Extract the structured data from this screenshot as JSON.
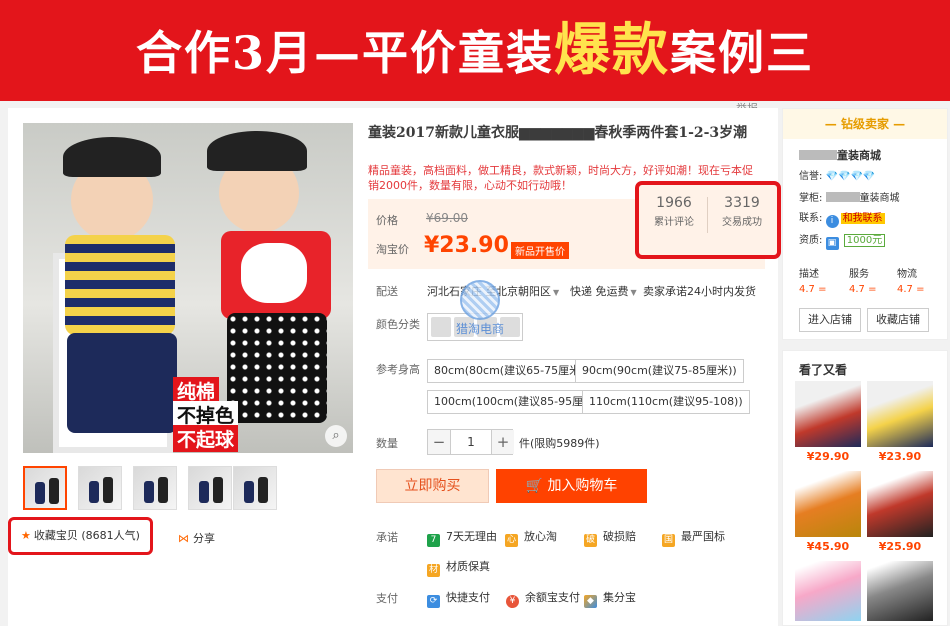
{
  "banner": {
    "text_before": "合作3月—平价童装",
    "text_hot": "爆款",
    "text_after": "案例三"
  },
  "report_link": "举报",
  "product": {
    "title": "童装2017新款儿童衣服▆▆▆▆▆▆▆春秋季两件套1-2-3岁潮",
    "subtitle": "精品童装，高档面料，做工精良，款式新颖，时尚大方，好评如潮！现在亏本促销2000件，数量有限，心动不如行动哦！",
    "image_badges": [
      "纯棉",
      "不掉色",
      "不起球"
    ],
    "price_label": "价格",
    "original_price": "¥69.00",
    "taobao_price_label": "淘宝价",
    "current_price": "¥23.90",
    "new_tag": "新品开售价",
    "stats": [
      {
        "value": "1966",
        "label": "累计评论"
      },
      {
        "value": "3319",
        "label": "交易成功"
      }
    ],
    "delivery_label": "配送",
    "delivery_from": "河北石家庄 至",
    "delivery_to": "北京朝阳区",
    "shipping": "快递 免运费",
    "promise_ship": "卖家承诺24小时内发货",
    "color_label": "颜色分类",
    "size_label": "参考身高",
    "sizes": [
      "80cm(80cm(建议65-75厘米))",
      "90cm(90cm(建议75-85厘米))",
      "100cm(100cm(建议85-95厘米)",
      "110cm(110cm(建议95-108))"
    ],
    "qty_label": "数量",
    "qty_value": "1",
    "qty_minus": "−",
    "qty_plus": "+",
    "qty_note": "件(限购5989件)",
    "buy_now": "立即购买",
    "add_cart": "加入购物车",
    "promise_label": "承诺",
    "promises": [
      "7天无理由",
      "放心淘",
      "破损赔",
      "最严国标",
      "材质保真"
    ],
    "pay_label": "支付",
    "payments": [
      "快捷支付",
      "余额宝支付",
      "集分宝"
    ],
    "fav_text": "收藏宝贝 (8681人气)",
    "share_text": "分享",
    "watermark_text": "猎淘电商"
  },
  "shop": {
    "level": "钻级卖家",
    "name_suffix": "童装商城",
    "credit_label": "信誉:",
    "credit_icons": "💎💎💎💎",
    "keeper_label": "掌柜:",
    "keeper_suffix": "童装商城",
    "contact_label": "联系:",
    "contact_btn": "和我联系",
    "qual_label": "资质:",
    "deposit": "1000元",
    "scores": [
      {
        "label": "描述",
        "value": "4.7 ="
      },
      {
        "label": "服务",
        "value": "4.7 ="
      },
      {
        "label": "物流",
        "value": "4.7 ="
      }
    ],
    "enter_shop": "进入店铺",
    "fav_shop": "收藏店铺"
  },
  "recommend": {
    "title": "看了又看",
    "prices": [
      "¥29.90",
      "¥23.90",
      "¥45.90",
      "¥25.90"
    ]
  },
  "colors": {
    "banner_red": "#e3151b",
    "price_orange": "#ff4400",
    "highlight_yellow": "#ffe34d"
  }
}
